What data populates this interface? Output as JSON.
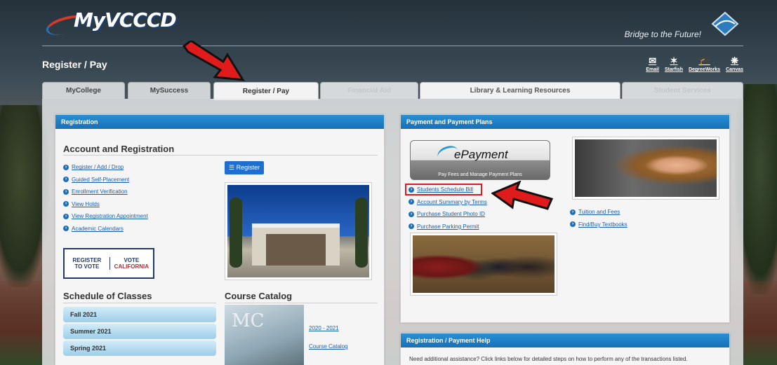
{
  "header": {
    "logo_text": "MyVCCCD",
    "tagline": "Bridge to the Future!",
    "page_title": "Register / Pay",
    "quick_links": [
      {
        "label": "Email",
        "icon": "envelope-icon"
      },
      {
        "label": "Starfish",
        "icon": "starfish-icon"
      },
      {
        "label": "DegreeWorks",
        "icon": "graduation-cap-icon"
      },
      {
        "label": "Canvas",
        "icon": "canvas-icon"
      }
    ]
  },
  "tabs": [
    "MyCollege",
    "MySuccess",
    "Register / Pay",
    "Financial Aid",
    "Library & Learning Resources",
    "Student Services"
  ],
  "registration": {
    "panel_title": "Registration",
    "section_title": "Account and Registration",
    "links": [
      "Register / Add / Drop",
      "Guided Self-Placement",
      "Enrollment Verification",
      "View Holds",
      "View Registration Appointment",
      "Academic Calendars"
    ],
    "register_button": "Register",
    "vote_left": "REGISTER TO VOTE",
    "vote_right_1": "VOTE",
    "vote_right_2": "CALIFORNIA"
  },
  "schedule": {
    "title": "Schedule of Classes",
    "terms": [
      "Fall 2021",
      "Summer 2021",
      "Spring 2021"
    ]
  },
  "catalog": {
    "title": "Course Catalog",
    "links": [
      "2020 - 2021",
      "Course Catalog"
    ]
  },
  "payment": {
    "panel_title": "Payment and Payment Plans",
    "epayment_title": "ePayment",
    "epayment_sub": "Pay Fees and Manage Payment Plans",
    "links": [
      "Students Schedule Bill",
      "Account Summary by Terms",
      "Purchase Student Photo ID",
      "Purchase Parking Permit"
    ],
    "right_links": [
      "Tuition and Fees",
      "Find/Buy Textbooks"
    ]
  },
  "help": {
    "panel_title": "Registration / Payment Help",
    "text": "Need additional assistance? Click links below for detailed steps on how to perform any of the transactions listed."
  }
}
